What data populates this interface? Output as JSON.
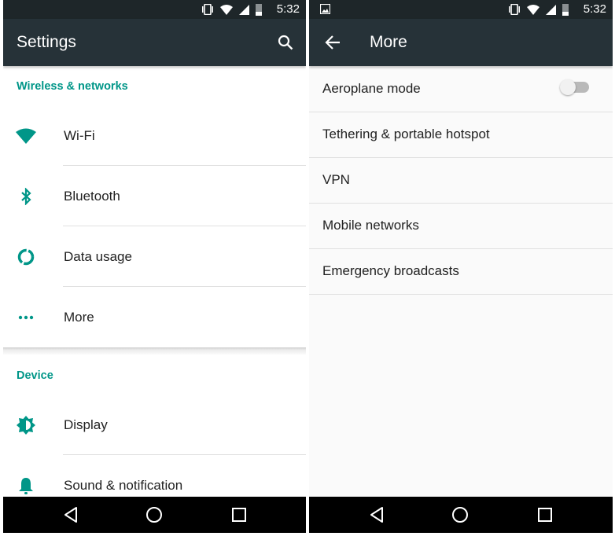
{
  "status_bar": {
    "time": "5:32",
    "icons": [
      "vibrate-icon",
      "wifi-icon",
      "signal-icon",
      "battery-icon"
    ],
    "right_extra_icon": "image-notification-icon"
  },
  "left_screen": {
    "title": "Settings",
    "action_icon": "search-icon",
    "sections": [
      {
        "header": "Wireless & networks",
        "items": [
          {
            "label": "Wi-Fi",
            "icon": "wifi-icon"
          },
          {
            "label": "Bluetooth",
            "icon": "bluetooth-icon"
          },
          {
            "label": "Data usage",
            "icon": "data-usage-icon"
          },
          {
            "label": "More",
            "icon": "more-dots-icon"
          }
        ]
      },
      {
        "header": "Device",
        "items": [
          {
            "label": "Display",
            "icon": "brightness-icon"
          },
          {
            "label": "Sound & notification",
            "icon": "bell-icon"
          }
        ]
      }
    ]
  },
  "right_screen": {
    "title": "More",
    "back_icon": "back-arrow-icon",
    "items": [
      {
        "label": "Aeroplane mode",
        "toggle": false
      },
      {
        "label": "Tethering & portable hotspot"
      },
      {
        "label": "VPN"
      },
      {
        "label": "Mobile networks"
      },
      {
        "label": "Emergency broadcasts"
      }
    ]
  },
  "nav_bar": {
    "buttons": [
      "back",
      "home",
      "recents"
    ]
  },
  "colors": {
    "accent": "#009688",
    "app_bar": "#263238",
    "status_bar": "#1e2629",
    "nav_bar": "#000000"
  }
}
